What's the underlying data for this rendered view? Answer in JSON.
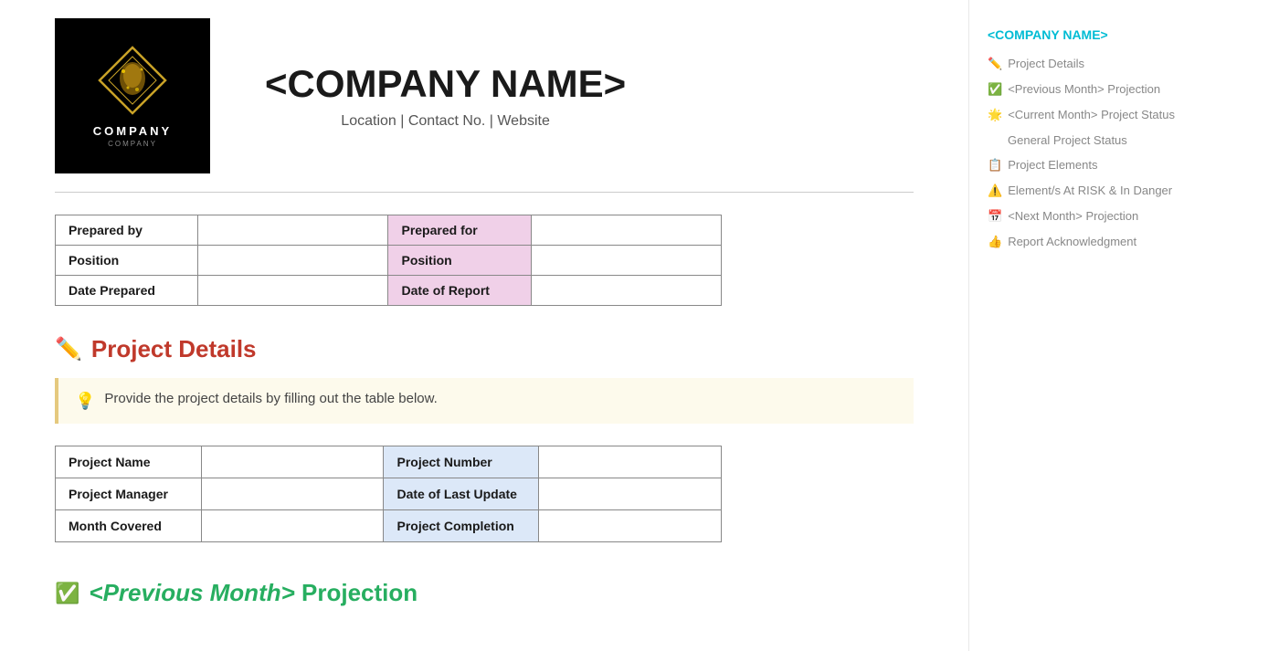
{
  "header": {
    "company_name": "<COMPANY NAME>",
    "company_tagline": "Location | Contact No. | Website",
    "logo_main": "COMPANY",
    "logo_sub": "COMPANY"
  },
  "info_table": {
    "rows": [
      {
        "label_left": "Prepared by",
        "value_left": "",
        "label_right": "Prepared for",
        "value_right": ""
      },
      {
        "label_left": "Position",
        "value_left": "",
        "label_right": "Position",
        "value_right": ""
      },
      {
        "label_left": "Date Prepared",
        "value_left": "",
        "label_right": "Date of Report",
        "value_right": ""
      }
    ]
  },
  "project_details_section": {
    "icon": "✏️",
    "title": "Project Details",
    "info_box": {
      "icon": "💡",
      "text": "Provide the project details by filling out the table below."
    },
    "table": {
      "rows": [
        {
          "label_left": "Project Name",
          "value_left": "",
          "label_right": "Project Number",
          "value_right": ""
        },
        {
          "label_left": "Project Manager",
          "value_left": "",
          "label_right": "Date of Last Update",
          "value_right": ""
        },
        {
          "label_left": "Month Covered",
          "value_left": "",
          "label_right": "Project Completion",
          "value_right": ""
        }
      ]
    }
  },
  "previous_month_section": {
    "icon": "✅",
    "title_prefix": "",
    "title_italic": "<Previous Month>",
    "title_suffix": " Projection"
  },
  "sidebar": {
    "company_name": "<COMPANY NAME>",
    "nav_items": [
      {
        "icon": "✏️",
        "text": "Project Details",
        "sub": false
      },
      {
        "icon": "✅",
        "text": "<Previous Month> Projection",
        "sub": false
      },
      {
        "icon": "🌟",
        "text": "<Current Month> Project Status",
        "sub": false
      },
      {
        "icon": "",
        "text": "General Project Status",
        "sub": true
      },
      {
        "icon": "📋",
        "text": "Project Elements",
        "sub": false
      },
      {
        "icon": "⚠️",
        "text": "Element/s At RISK & In Danger",
        "sub": false
      },
      {
        "icon": "📅",
        "text": "<Next Month> Projection",
        "sub": false
      },
      {
        "icon": "👍",
        "text": "Report Acknowledgment",
        "sub": false
      }
    ]
  }
}
